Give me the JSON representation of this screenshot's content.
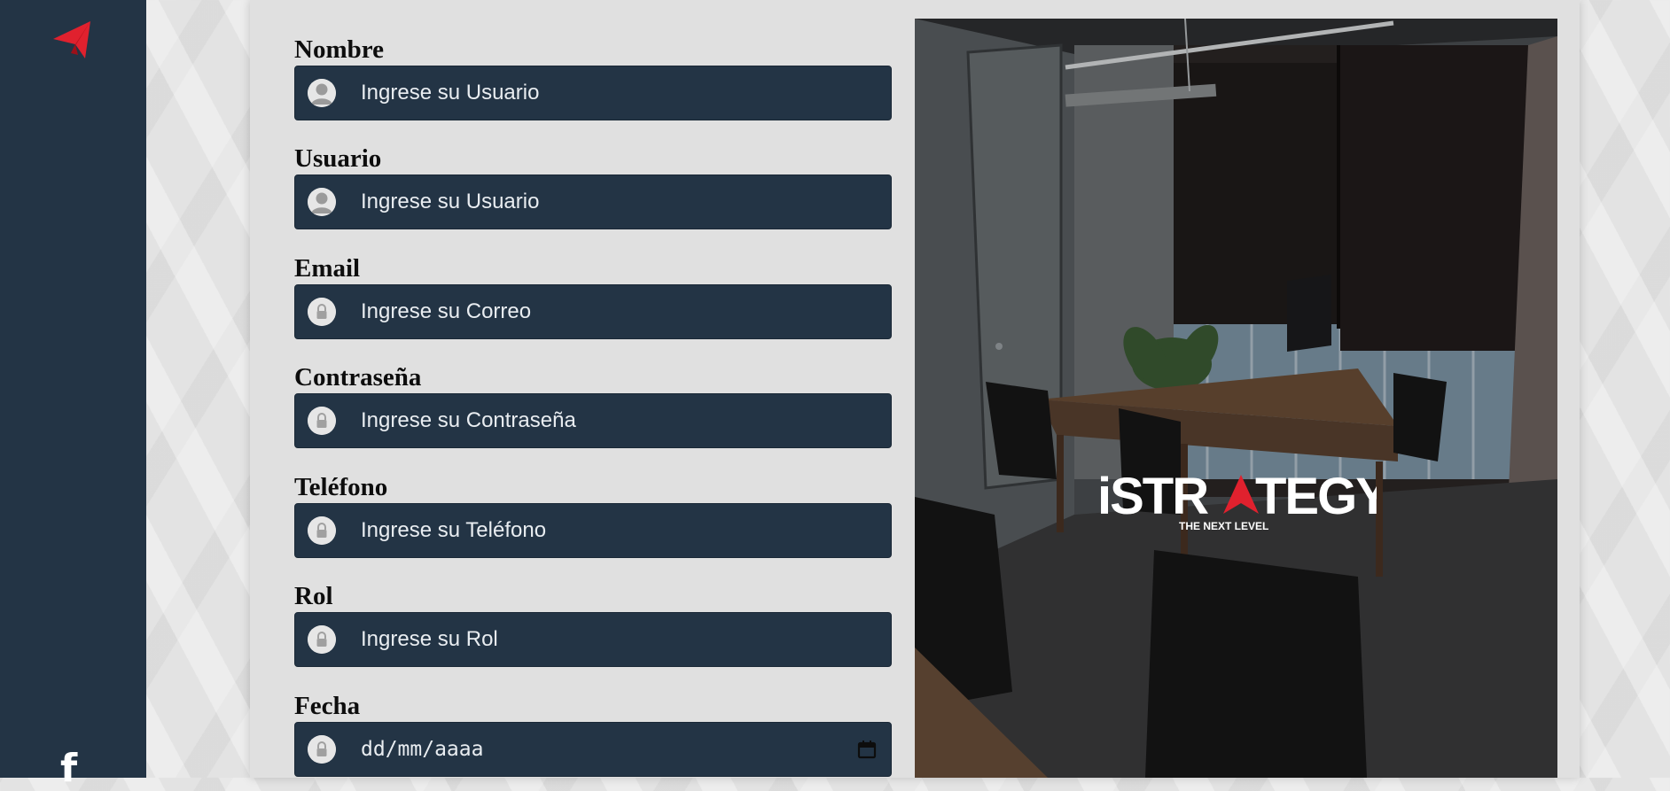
{
  "sidebar": {
    "logo_icon": "paper-plane-icon",
    "social_icon": "facebook-icon",
    "social_glyph": "f",
    "accent": "#e0212e",
    "background": "#233445"
  },
  "form": {
    "fields": [
      {
        "label": "Nombre",
        "placeholder": "Ingrese su Usuario",
        "icon": "user-icon"
      },
      {
        "label": "Usuario",
        "placeholder": "Ingrese su Usuario",
        "icon": "user-icon"
      },
      {
        "label": "Email",
        "placeholder": "Ingrese su Correo",
        "icon": "lock-icon"
      },
      {
        "label": "Contraseña",
        "placeholder": "Ingrese su Contraseña",
        "icon": "lock-icon"
      },
      {
        "label": "Teléfono",
        "placeholder": "Ingrese su Teléfono",
        "icon": "lock-icon"
      },
      {
        "label": "Rol",
        "placeholder": "Ingrese su Rol",
        "icon": "lock-icon"
      },
      {
        "label": "Fecha",
        "placeholder": "dd/mm/aaaa",
        "icon": "lock-icon"
      }
    ],
    "field_color": "#233445"
  },
  "image": {
    "alt": "office meeting room",
    "brand_name": "iSTRATEGY",
    "brand_tagline": "THE NEXT LEVEL"
  }
}
